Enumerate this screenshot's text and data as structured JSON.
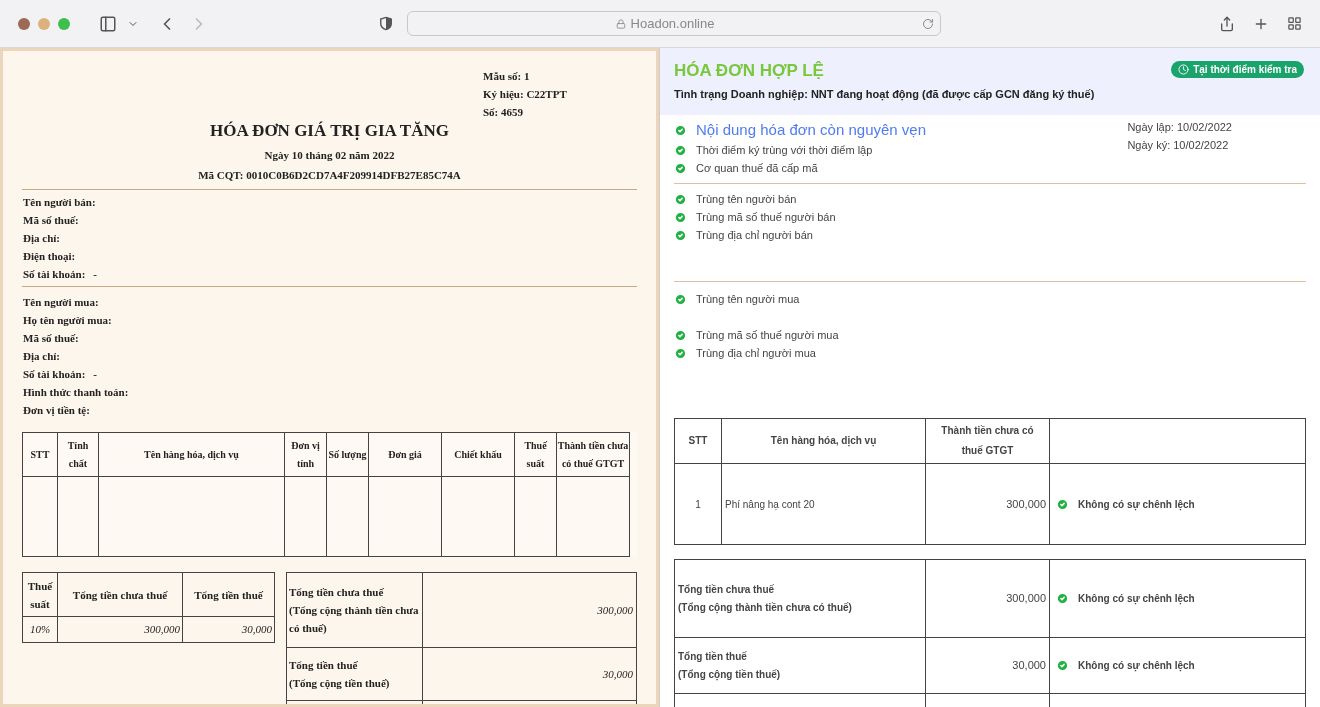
{
  "browser": {
    "address": "Hoadon.online",
    "forward_disabled": true
  },
  "invoice": {
    "meta": [
      "Mẫu số: 1",
      "Ký hiệu: C22TPT",
      "Số: 4659"
    ],
    "title": "HÓA ĐƠN GIÁ TRỊ GIA TĂNG",
    "date": "Ngày 10 tháng 02 năm 2022",
    "cqt_code": "Mã CQT: 0010C0B6D2CD7A4F209914DFB27E85C74A",
    "seller_fields": [
      {
        "label": "Tên người bán:"
      },
      {
        "label": "Mã số thuế:"
      },
      {
        "label": "Địa chỉ:"
      },
      {
        "label": "Điện thoại:"
      },
      {
        "label": "Số tài khoản:",
        "value": "-"
      }
    ],
    "buyer_fields": [
      {
        "label": "Tên người mua:"
      },
      {
        "label": "Họ tên người mua:"
      },
      {
        "label": "Mã số thuế:"
      },
      {
        "label": "Địa chỉ:"
      },
      {
        "label": "Số tài khoản:",
        "value": "-"
      },
      {
        "label": "Hình thức thanh toán:"
      },
      {
        "label": "Đơn vị tiền tệ:"
      }
    ],
    "items_table": {
      "columns": [
        "STT",
        "Tính chất",
        "Tên hàng hóa, dịch vụ",
        "Đơn vị tính",
        "Số lượng",
        "Đơn giá",
        "Chiết khấu",
        "Thuế suất",
        "Thành tiền chưa có thuế GTGT"
      ]
    },
    "tax_summary": {
      "columns": [
        "Thuế suất",
        "Tổng tiền chưa thuế",
        "Tổng tiền thuế"
      ],
      "rows": [
        [
          "10%",
          "300,000",
          "30,000"
        ]
      ]
    },
    "totals": [
      {
        "label": "Tổng tiền chưa thuế",
        "sublabel": "(Tổng cộng thành tiền chưa có thuế)",
        "value": "300,000"
      },
      {
        "label": "Tổng tiền thuế",
        "sublabel": "(Tổng cộng tiền thuế)",
        "value": "30,000"
      }
    ]
  },
  "verification": {
    "title": "HÓA ĐƠN HỢP LỆ",
    "status": "Tình trạng Doanh nghiệp: **NNT đang hoạt động (đã được cấp GCN đăng ký thuế)**",
    "time_button": "Tại thời điểm kiểm tra",
    "dates": [
      "Ngày lập: 10/02/2022",
      "Ngày ký: 10/02/2022"
    ],
    "check_groups": [
      [
        {
          "kind": "headline",
          "text": "Nội dung hóa đơn còn nguyên vẹn",
          "passed": true
        },
        {
          "kind": "item",
          "text": "Thời điểm ký trùng với thời điểm lập",
          "passed": true
        },
        {
          "kind": "item",
          "text": "Cơ quan thuế đã cấp mã",
          "passed": true
        }
      ],
      [
        {
          "kind": "item",
          "text": "Trùng tên người bán",
          "passed": true
        },
        {
          "kind": "item",
          "text": "Trùng mã số thuế người bán",
          "passed": true
        },
        {
          "kind": "item",
          "text": "Trùng địa chỉ người bán",
          "passed": true
        }
      ],
      [
        {
          "kind": "item",
          "text": "Trùng tên người mua",
          "passed": true
        },
        {
          "kind": "item",
          "text": "Trùng mã số thuế người mua",
          "passed": true
        },
        {
          "kind": "item",
          "text": "Trùng địa chỉ người mua",
          "passed": true
        }
      ]
    ],
    "compare_table": {
      "columns": [
        "STT",
        "Tên hàng hóa, dịch vụ",
        "Thành tiền chưa có thuế GTGT"
      ],
      "rows": [
        {
          "stt": "1",
          "name": "Phí nâng hạ cont 20",
          "amount": "300,000",
          "result": "Không có sự chênh lệch",
          "passed": true
        }
      ]
    },
    "compare_totals": [
      {
        "label": "Tổng tiền chưa thuế",
        "sublabel": "(Tổng cộng thành tiền chưa có thuế)",
        "amount": "300,000",
        "result": "Không có sự chênh lệch",
        "passed": true
      },
      {
        "label": "Tổng tiền thuế",
        "sublabel": "(Tổng cộng tiền thuế)",
        "amount": "30,000",
        "result": "Không có sự chênh lệch",
        "passed": true
      }
    ]
  }
}
